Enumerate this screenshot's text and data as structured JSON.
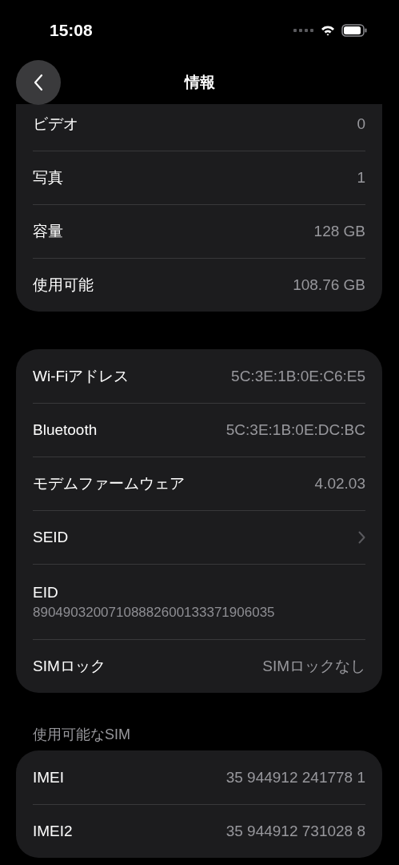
{
  "status_bar": {
    "time": "15:08"
  },
  "nav": {
    "title": "情報"
  },
  "sections": [
    {
      "rows": [
        {
          "kind": "value",
          "label": "ビデオ",
          "value": "0"
        },
        {
          "kind": "value",
          "label": "写真",
          "value": "1"
        },
        {
          "kind": "value",
          "label": "容量",
          "value": "128 GB"
        },
        {
          "kind": "value",
          "label": "使用可能",
          "value": "108.76 GB"
        }
      ]
    },
    {
      "rows": [
        {
          "kind": "value",
          "label": "Wi-Fiアドレス",
          "value": "5C:3E:1B:0E:C6:E5"
        },
        {
          "kind": "value",
          "label": "Bluetooth",
          "value": "5C:3E:1B:0E:DC:BC"
        },
        {
          "kind": "value",
          "label": "モデムファームウェア",
          "value": "4.02.03"
        },
        {
          "kind": "link",
          "label": "SEID"
        },
        {
          "kind": "stacked",
          "label": "EID",
          "value": "89049032007108882600133371906035"
        },
        {
          "kind": "value",
          "label": "SIMロック",
          "value": "SIMロックなし"
        }
      ]
    },
    {
      "header": "使用可能なSIM",
      "rows": [
        {
          "kind": "value",
          "label": "IMEI",
          "value": "35 944912 241778 1"
        },
        {
          "kind": "value",
          "label": "IMEI2",
          "value": "35 944912 731028 8"
        }
      ]
    }
  ]
}
